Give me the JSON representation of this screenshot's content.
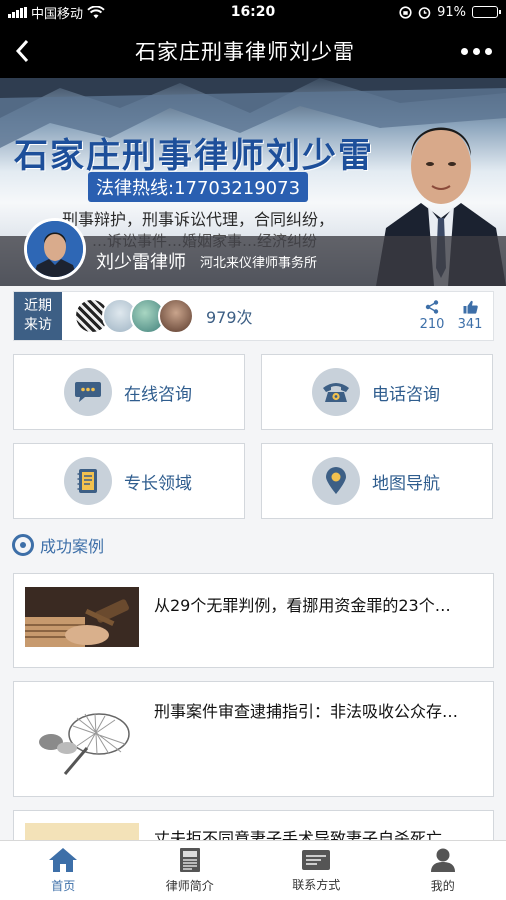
{
  "status": {
    "carrier": "中国移动",
    "time": "16:20",
    "battery": "91%",
    "battery_level": 0.91
  },
  "nav": {
    "title": "石家庄刑事律师刘少雷"
  },
  "banner": {
    "name": "石家庄刑事律师刘少雷",
    "hotline": "法律热线:17703219073",
    "services": "刑事辩护，刑事诉讼代理，合同纠纷，",
    "services2": "…诉讼事件…婚姻家事…经济纠纷",
    "lawyer": "刘少雷律师",
    "firm": "河北来仪律师事务所"
  },
  "visitors": {
    "label_line1": "近期",
    "label_line2": "来访",
    "count": "979次",
    "shares": "210",
    "likes": "341"
  },
  "quick": {
    "online": "在线咨询",
    "phone": "电话咨询",
    "expertise": "专长领域",
    "map": "地图导航"
  },
  "section": {
    "title": "成功案例"
  },
  "cases": [
    {
      "title": "从29个无罪判例，看挪用资金罪的23个…"
    },
    {
      "title": "刑事案件审查逮捕指引：非法吸收公众存…"
    },
    {
      "title": "丈夫拒不同意妻子手术导致妻子自杀死亡…"
    }
  ],
  "tabs": {
    "home": "首页",
    "profile": "律师简介",
    "contact": "联系方式",
    "mine": "我的"
  },
  "colors": {
    "accent": "#3d6fa8",
    "navy": "#3d5f85",
    "battery": "#f5c419"
  }
}
